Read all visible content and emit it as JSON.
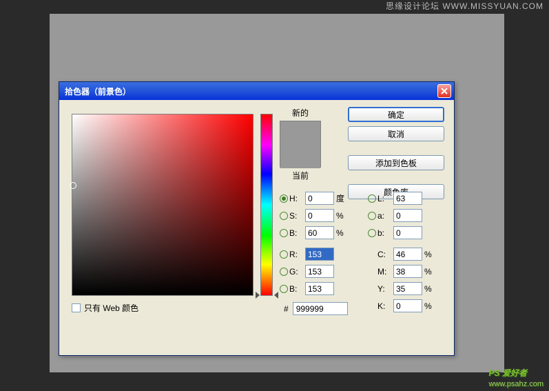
{
  "watermark_top": "思缘设计论坛 WWW.MISSYUAN.COM",
  "watermark_bottom": "PS 爱好者",
  "watermark_bottom_url": "www.psahz.com",
  "dialog": {
    "title": "拾色器（前景色）",
    "new_label": "新的",
    "current_label": "当前",
    "buttons": {
      "ok": "确定",
      "cancel": "取消",
      "add_swatch": "添加到色板",
      "color_lib": "颜色库"
    },
    "hsb": {
      "h_label": "H:",
      "h_value": "0",
      "h_unit": "度",
      "s_label": "S:",
      "s_value": "0",
      "s_unit": "%",
      "b_label": "B:",
      "b_value": "60",
      "b_unit": "%"
    },
    "lab": {
      "l_label": "L:",
      "l_value": "63",
      "a_label": "a:",
      "a_value": "0",
      "b_label": "b:",
      "b_value": "0"
    },
    "rgb": {
      "r_label": "R:",
      "r_value": "153",
      "g_label": "G:",
      "g_value": "153",
      "b_label": "B:",
      "b_value": "153"
    },
    "cmyk": {
      "c_label": "C:",
      "c_value": "46",
      "unit": "%",
      "m_label": "M:",
      "m_value": "38",
      "y_label": "Y:",
      "y_value": "35",
      "k_label": "K:",
      "k_value": "0"
    },
    "hex_label": "#",
    "hex_value": "999999",
    "web_only_label": "只有 Web 颜色",
    "selected_color": "#999999"
  }
}
